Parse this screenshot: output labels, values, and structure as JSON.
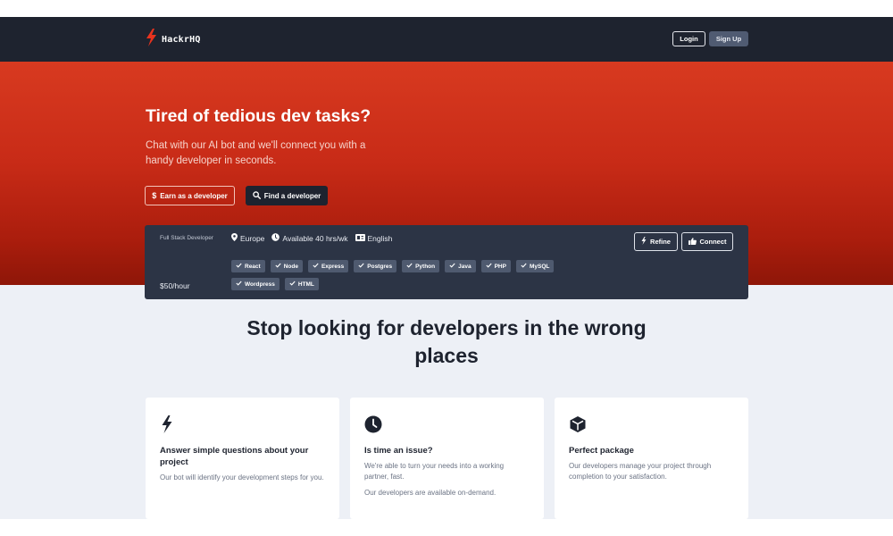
{
  "nav": {
    "brand": "HackrHQ",
    "login_label": "Login",
    "signup_label": "Sign Up"
  },
  "hero": {
    "title": "Tired of tedious dev tasks?",
    "subtitle": "Chat with our AI bot and we'll connect you with a handy developer in seconds.",
    "earn_label": "Earn as a developer",
    "find_label": "Find a developer"
  },
  "developer_card": {
    "role": "Full Stack Developer",
    "rate": "$50/hour",
    "location": "Europe",
    "availability": "Available 40 hrs/wk",
    "language": "English",
    "skills": [
      "React",
      "Node",
      "Express",
      "Postgres",
      "Python",
      "Java",
      "PHP",
      "MySQL",
      "Wordpress",
      "HTML"
    ],
    "refine_label": "Refine",
    "connect_label": "Connect"
  },
  "section": {
    "title": "Stop looking for developers in the wrong places"
  },
  "features": [
    {
      "icon": "bolt-icon",
      "title": "Answer simple questions about your project",
      "paragraphs": [
        "Our bot will identify your development steps for you."
      ]
    },
    {
      "icon": "clock-icon",
      "title": "Is time an issue?",
      "paragraphs": [
        "We're able to turn your needs into a working partner, fast.",
        "Our developers are available on-demand."
      ]
    },
    {
      "icon": "cube-icon",
      "title": "Perfect package",
      "paragraphs": [
        "Our developers manage your project through completion to your satisfaction."
      ]
    }
  ],
  "colors": {
    "navbar": "#1e232f",
    "hero_top": "#d83a20",
    "hero_bottom": "#8e1608",
    "brand_accent": "#e8331e",
    "card": "#2c3445",
    "tag": "#4f5a6f",
    "section_bg": "#edf0f6"
  }
}
